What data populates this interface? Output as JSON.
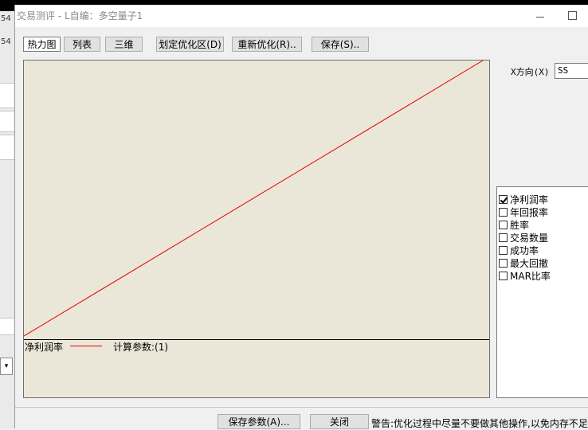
{
  "background_app": {
    "left_number_1": "54",
    "left_number_2": "54",
    "combo_arrow": "▾"
  },
  "titlebar": {
    "title": "交易测评 - L自编：多空量子1"
  },
  "view_tabs": [
    {
      "label": "热力图",
      "active": true
    },
    {
      "label": "列表",
      "active": false
    },
    {
      "label": "三维",
      "active": false
    }
  ],
  "toolbar": {
    "define_area_label": "划定优化区(D)",
    "reoptimize_label": "重新优化(R)..",
    "save_label": "保存(S).."
  },
  "x_direction": {
    "label": "X方向(X)",
    "selected": "SS"
  },
  "chart_data": {
    "type": "line",
    "series": [
      {
        "name": "净利润率",
        "color": "#e00000",
        "points": [
          [
            0,
            0
          ],
          [
            1,
            1
          ]
        ]
      }
    ],
    "legend_param": "计算参数:(1)",
    "grid": false
  },
  "metrics": [
    {
      "label": "净利润率",
      "checked": true
    },
    {
      "label": "年回报率",
      "checked": false
    },
    {
      "label": "胜率",
      "checked": false
    },
    {
      "label": "交易数量",
      "checked": false
    },
    {
      "label": "成功率",
      "checked": false
    },
    {
      "label": "最大回撤",
      "checked": false
    },
    {
      "label": "MAR比率",
      "checked": false
    }
  ],
  "footer": {
    "save_params_label": "保存参数(A)...",
    "close_label": "关闭",
    "warning": "警告:优化过程中尽量不要做其他操作,以免内存不足"
  },
  "colors": {
    "chart_bg": "#ebe7d8",
    "series_line": "#e00000",
    "dialog_bg": "#f0f0f0"
  }
}
